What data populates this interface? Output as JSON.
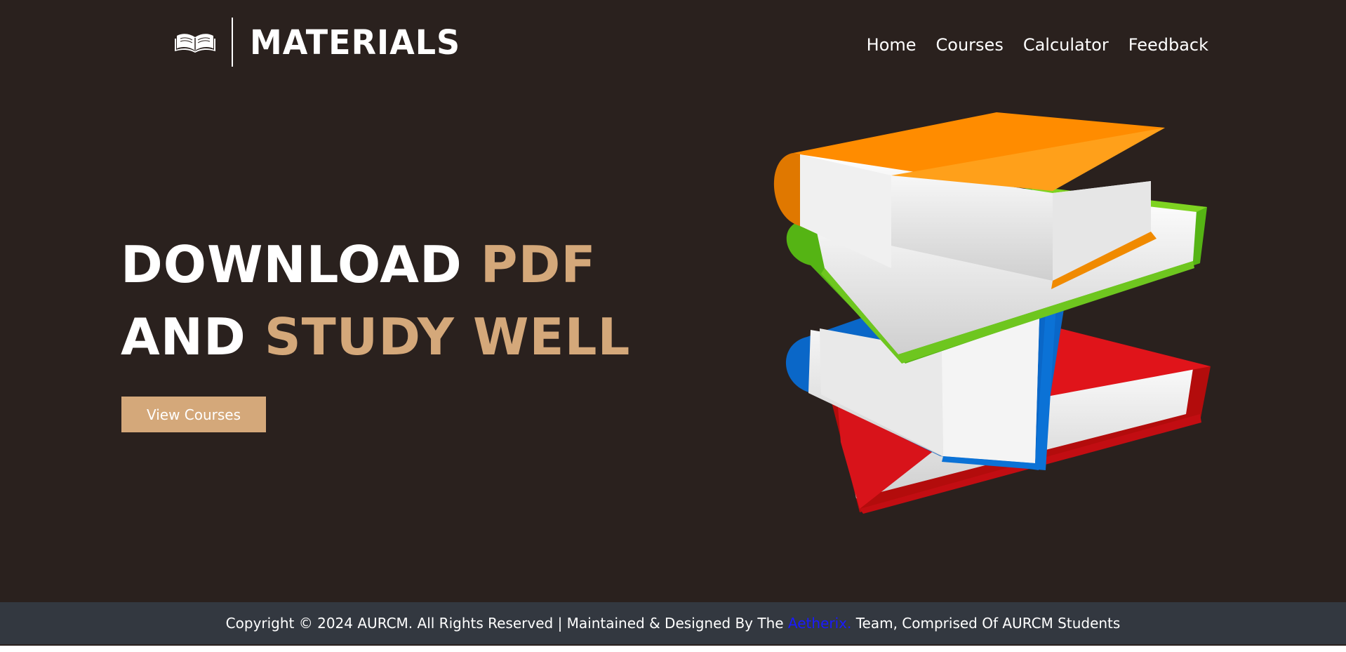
{
  "header": {
    "logo_text": "MATERIALS",
    "logo_icon": "open-book-icon",
    "nav": [
      {
        "label": "Home"
      },
      {
        "label": "Courses"
      },
      {
        "label": "Calculator"
      },
      {
        "label": "Feedback"
      }
    ]
  },
  "hero": {
    "line1_white": "DOWNLOAD ",
    "line1_accent": "PDF",
    "line2_white": "AND ",
    "line2_accent": "STUDY WELL",
    "button_label": "View Courses",
    "image_icon": "stacked-books-illustration"
  },
  "footer": {
    "text_before": "Copyright © 2024 AURCM. All Rights Reserved | Maintained & Designed By The ",
    "link_text": "Aetherix.",
    "text_after": " Team, Comprised Of AURCM Students"
  },
  "colors": {
    "background": "#2a211e",
    "accent": "#d4a87a",
    "footer_bg": "#333840",
    "link": "#1a1aff"
  }
}
